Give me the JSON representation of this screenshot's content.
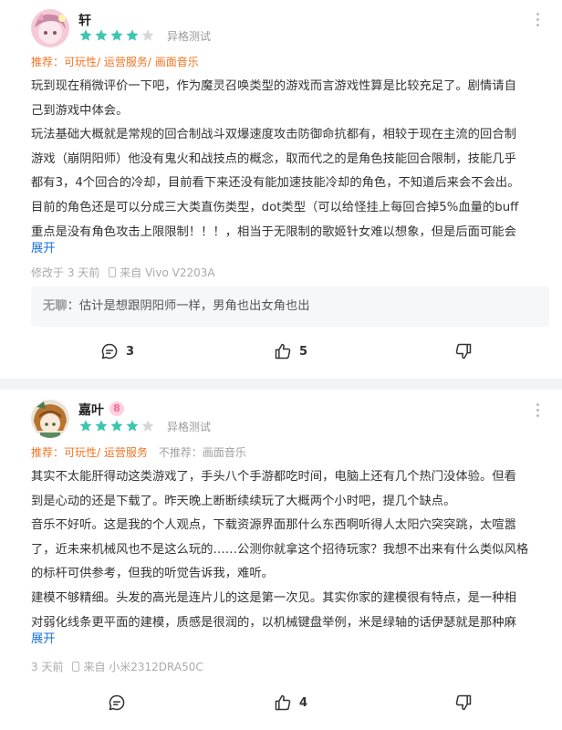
{
  "reviews": [
    {
      "username": "轩",
      "stars": 4,
      "device_label": "异格测试",
      "recommend": "推荐：可玩性/ 运营服务/ 画面音乐",
      "content": [
        "玩到现在稍微评价一下吧，作为魔灵召唤类型的游戏而言游戏性算是比较充足了。剧情请自",
        "己到游戏中体会。",
        "玩法基础大概就是常规的回合制战斗双爆速度攻击防御命抗都有，相较于现在主流的回合制",
        "游戏（崩阴阳师）他没有鬼火和战技点的概念，取而代之的是角色技能回合限制，技能几乎",
        "都有3，4个回合的冷却，目前看下来还没有能加速技能冷却的角色，不知道后来会不会出。",
        "目前的角色还是可以分成三大类直伤类型，dot类型（可以给怪挂上每回合掉5%血量的buff",
        "重点是没有角色攻击上限限制！！！，相当于无限制的歌姬针女难以想象，但是后面可能会"
      ],
      "expand": "展开",
      "modified": "修改于 3 天前",
      "source": "来自 Vivo V2203A",
      "reply": {
        "name": "无聊",
        "text": "：估计是想跟阴阳师一样，男角也出女角也出"
      },
      "comments": "3",
      "likes": "5"
    },
    {
      "username": "嘉叶",
      "level": "8",
      "stars": 4,
      "device_label": "异格测试",
      "recommend": "推荐：可玩性/ 运营服务",
      "not_recommend": "不推荐：画面音乐",
      "content": [
        "其实不太能肝得动这类游戏了，手头八个手游都吃时间，电脑上还有几个热门没体验。但看",
        "到是心动的还是下载了。昨天晚上断断续续玩了大概两个小时吧，提几个缺点。",
        "音乐不好听。这是我的个人观点，下载资源界面那什么东西啊听得人太阳穴突突跳，太喧嚣",
        "了，近未来机械风也不是这么玩的……公测你就拿这个招待玩家？我想不出来有什么类似风格",
        "的标杆可供参考，但我的听觉告诉我，难听。",
        "建模不够精细。头发的高光是连片儿的这是第一次见。其实你家的建模很有特点，是一种相",
        "对弱化线条更平面的建模，质感是很润的，以机械键盘举例，米是绿轴的话伊瑟就是那种麻"
      ],
      "expand": "展开",
      "modified": "3 天前",
      "source": "来自 小米2312DRA50C",
      "comments": "",
      "likes": "4"
    }
  ],
  "colors": {
    "star_on": "#3ec5b0",
    "star_off": "#d8d8d8",
    "recommend": "#f07524",
    "link": "#1a73d9"
  }
}
